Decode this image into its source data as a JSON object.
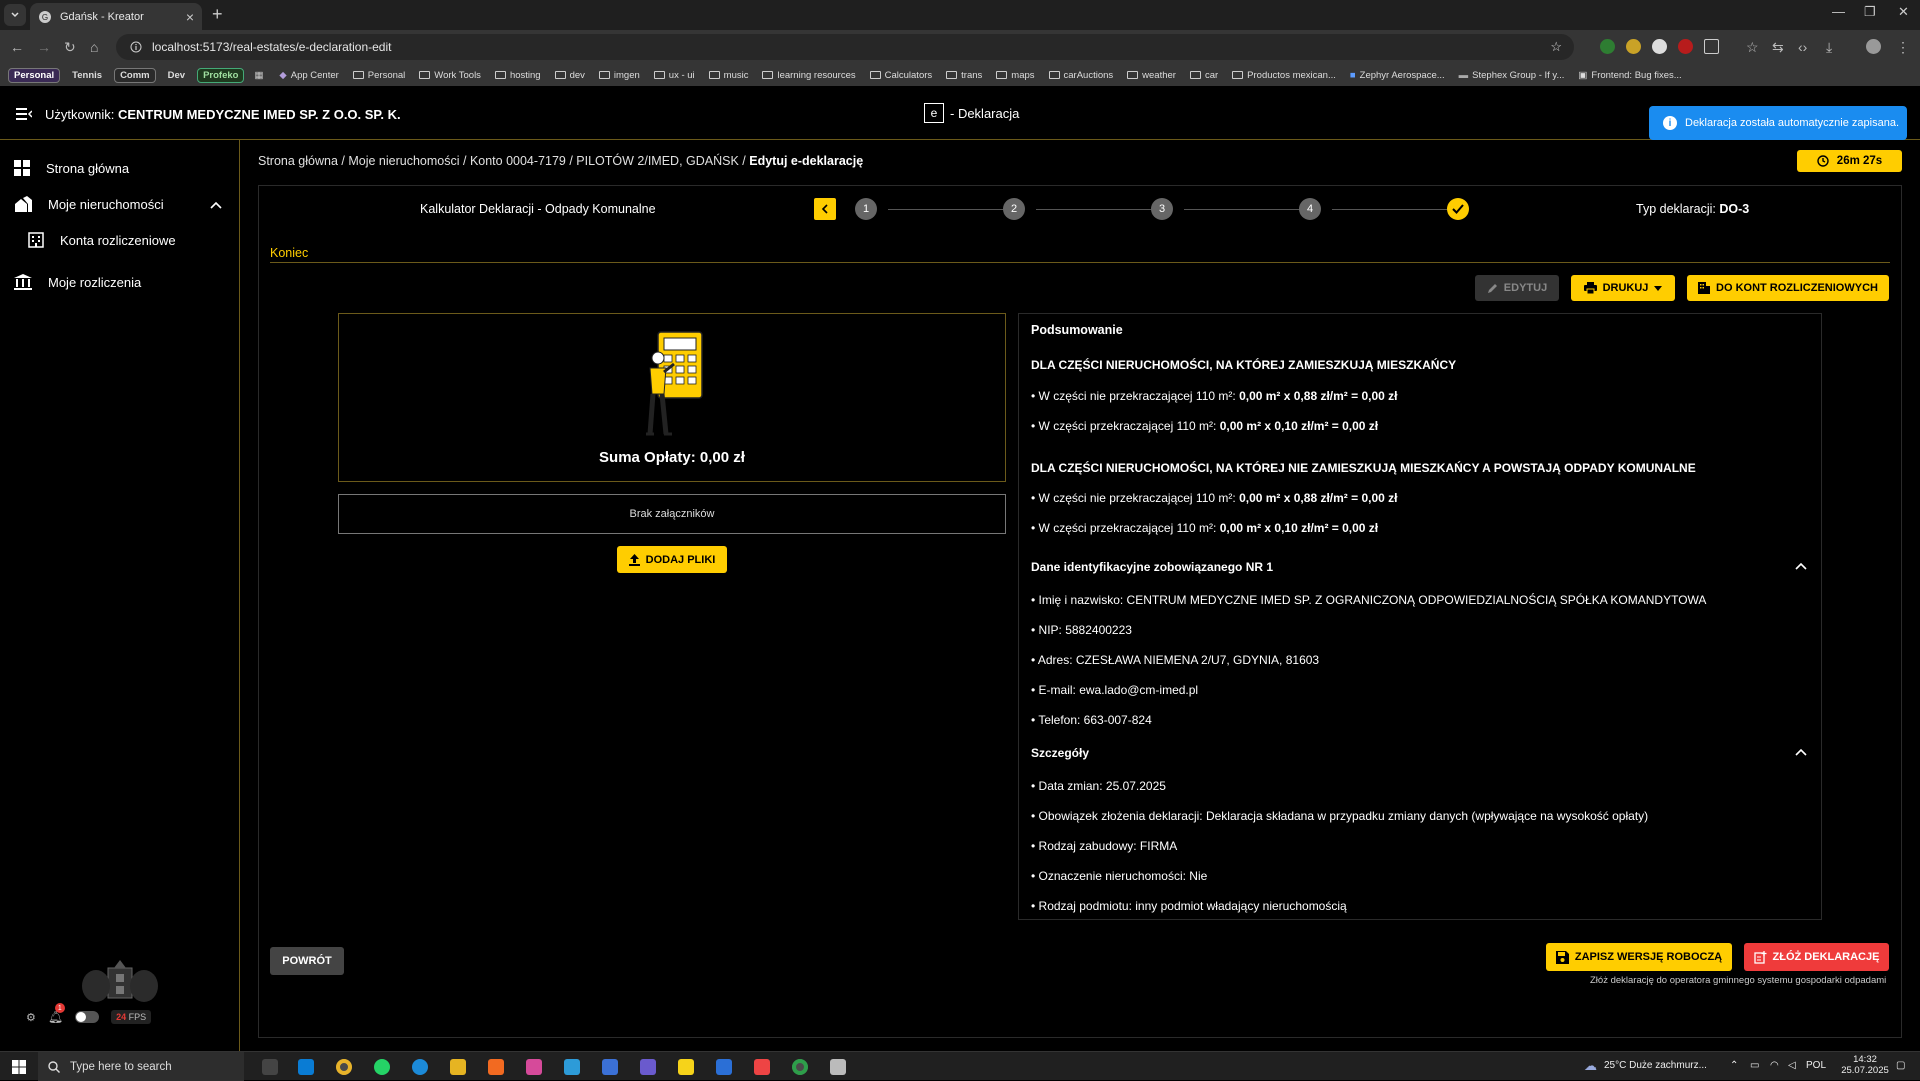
{
  "browser": {
    "tab_title": "Gdańsk - Kreator",
    "url": "localhost:5173/real-estates/e-declaration-edit",
    "bookmarks_chips": [
      "Personal",
      "Tennis",
      "Comm",
      "Dev",
      "Profeko"
    ],
    "bookmarks": [
      "App Center",
      "Personal",
      "Work Tools",
      "hosting",
      "dev",
      "imgen",
      "ux - ui",
      "music",
      "learning resources",
      "Calculators",
      "trans",
      "maps",
      "carAuctions",
      "weather",
      "car",
      "Productos mexican...",
      "Zephyr Aerospace...",
      "Stephex Group - If y...",
      "Frontend: Bug fixes..."
    ]
  },
  "header": {
    "user_label": "Użytkownik:",
    "user_name": "CENTRUM MEDYCZNE IMED SP. Z O.O. SP. K.",
    "brand_e": "e",
    "brand_text": "- Deklaracja",
    "toast": "Deklaracja została automatycznie zapisana."
  },
  "sidebar": {
    "items": [
      {
        "label": "Strona główna",
        "icon": "dashboard-icon"
      },
      {
        "label": "Moje nieruchomości",
        "icon": "home-group-icon"
      },
      {
        "label": "Konta rozliczeniowe",
        "icon": "building-icon"
      },
      {
        "label": "Moje rozliczenia",
        "icon": "bank-icon"
      }
    ],
    "notif_count": "1",
    "fps_value": "24",
    "fps_label": "FPS"
  },
  "breadcrumb": [
    "Strona główna",
    "Moje nieruchomości",
    "Konto 0004-7179",
    "PILOTÓW 2/IMED, GDAŃSK",
    "Edytuj e-deklarację"
  ],
  "timer": "26m 27s",
  "stepper": {
    "title": "Kalkulator Deklaracji - Odpady Komunalne",
    "steps": [
      "1",
      "2",
      "3",
      "4"
    ],
    "typ_label": "Typ deklaracji:",
    "typ_value": "DO-3"
  },
  "section_label": "Koniec",
  "actions": {
    "edit": "EDYTUJ",
    "print": "DRUKUJ",
    "accounts": "DO KONT ROZLICZENIOWYCH",
    "add_files": "DODAJ PLIKI",
    "back": "POWRÓT",
    "save_draft": "ZAPISZ WERSJĘ ROBOCZĄ",
    "submit": "ZŁÓŻ DEKLARACJĘ",
    "submit_note": "Złóż deklarację do operatora gminnego systemu gospodarki odpadami"
  },
  "result": {
    "suma": "Suma Opłaty: 0,00 zł",
    "attachments": "Brak załączników"
  },
  "summary": {
    "title": "Podsumowanie",
    "group1_title": "DLA CZĘŚCI NIERUCHOMOŚCI, NA KTÓREJ ZAMIESZKUJĄ MIESZKAŃCY",
    "group1": [
      {
        "label": "• W części nie przekraczającej 110 m²:",
        "value": "0,00 m² x 0,88 zł/m² = 0,00 zł"
      },
      {
        "label": "• W części przekraczającej 110 m²:",
        "value": "0,00 m² x 0,10 zł/m² = 0,00 zł"
      }
    ],
    "group2_title": "DLA CZĘŚCI NIERUCHOMOŚCI, NA KTÓREJ NIE ZAMIESZKUJĄ MIESZKAŃCY A POWSTAJĄ ODPADY KOMUNALNE",
    "group2": [
      {
        "label": "• W części nie przekraczającej 110 m²:",
        "value": "0,00 m² x 0,88 zł/m² = 0,00 zł"
      },
      {
        "label": "• W części przekraczającej 110 m²:",
        "value": "0,00 m² x 0,10 zł/m² = 0,00 zł"
      }
    ],
    "ident_title": "Dane identyfikacyjne zobowiązanego NR 1",
    "ident": [
      "• Imię i nazwisko: CENTRUM MEDYCZNE IMED SP. Z OGRANICZONĄ ODPOWIEDZIALNOŚCIĄ SPÓŁKA KOMANDYTOWA",
      "• NIP: 5882400223",
      "• Adres: CZESŁAWA NIEMENA 2/U7, GDYNIA, 81603",
      "• E-mail: ewa.lado@cm-imed.pl",
      "• Telefon: 663-007-824"
    ],
    "details_title": "Szczegóły",
    "details": [
      "• Data zmian: 25.07.2025",
      "• Obowiązek złożenia deklaracji: Deklaracja składana w przypadku zmiany danych (wpływające na wysokość opłaty)",
      "• Rodzaj zabudowy: FIRMA",
      "• Oznaczenie nieruchomości: Nie",
      "• Rodzaj podmiotu: inny podmiot władający nieruchomością"
    ]
  },
  "taskbar": {
    "search_placeholder": "Type here to search",
    "weather": "25°C  Duże zachmurz...",
    "lang": "POL",
    "time": "14:32",
    "date": "25.07.2025"
  },
  "colors": {
    "accent": "#ffcd00",
    "danger": "#ef3b3b",
    "info": "#1a8cf0"
  }
}
